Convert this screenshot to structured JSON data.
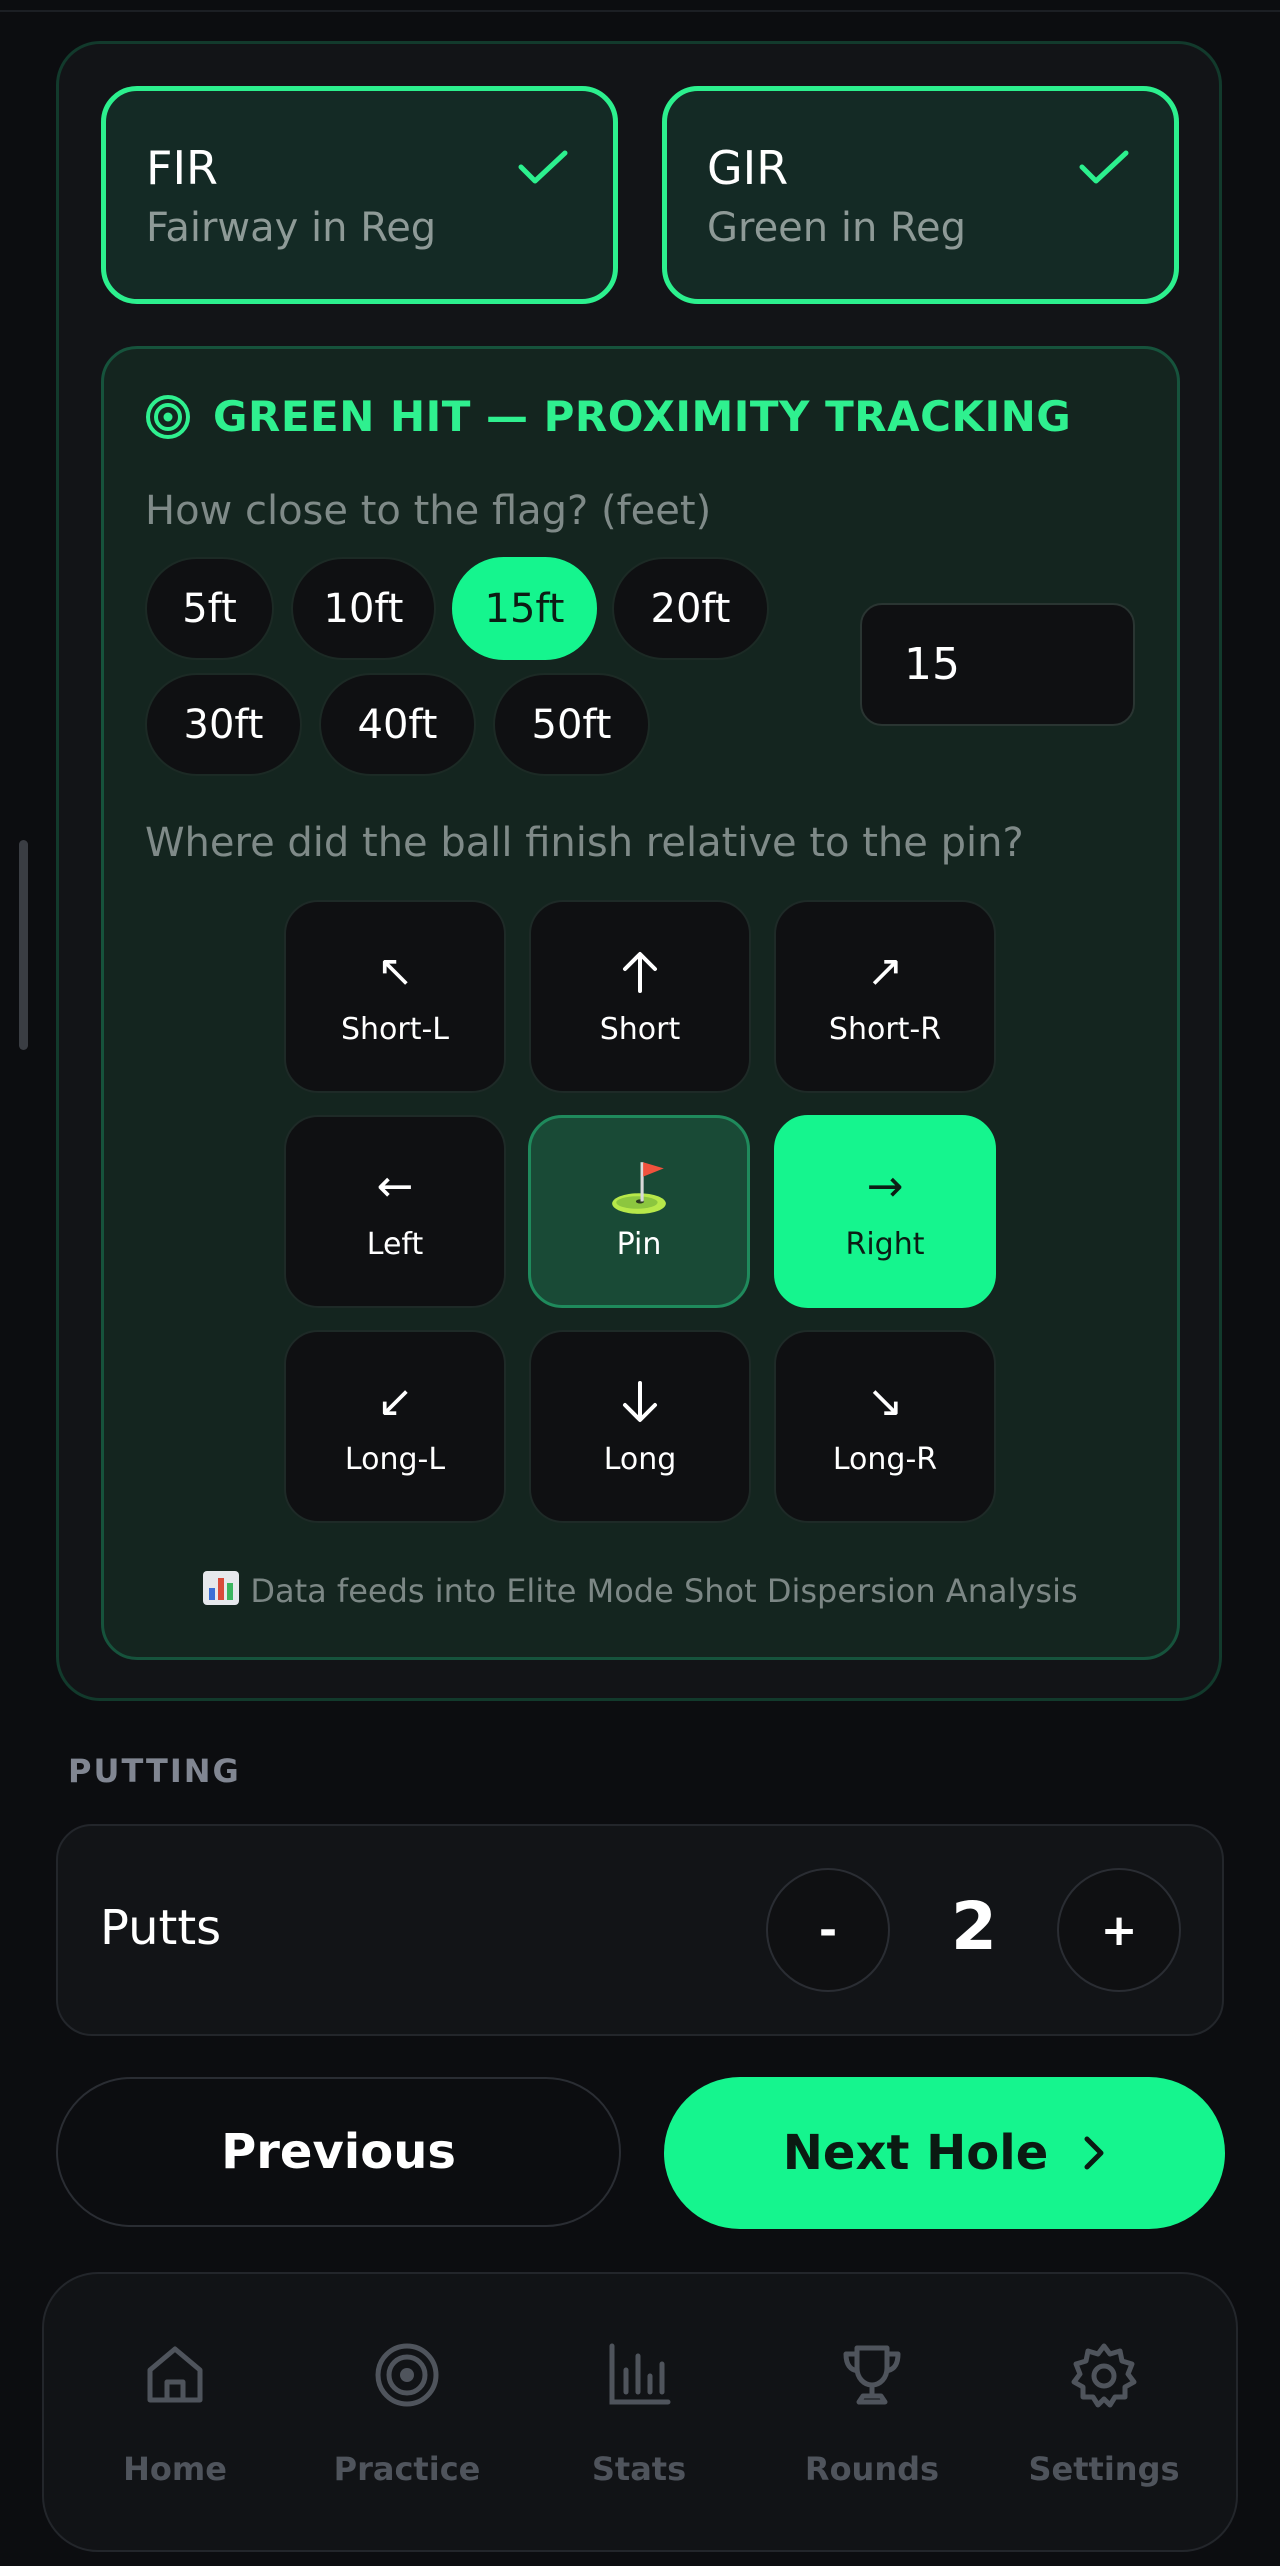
{
  "fir": {
    "title": "FIR",
    "subtitle": "Fairway in Reg",
    "checked": true
  },
  "gir": {
    "title": "GIR",
    "subtitle": "Green in Reg",
    "checked": true
  },
  "proximity": {
    "title": "GREEN HIT — PROXIMITY TRACKING",
    "distance_question": "How close to the flag? (feet)",
    "distance_chips": [
      "5ft",
      "10ft",
      "15ft",
      "20ft",
      "30ft",
      "40ft",
      "50ft"
    ],
    "selected_chip": "15ft",
    "distance_value": "15",
    "position_question": "Where did the ball finish relative to the pin?",
    "positions": [
      {
        "label": "Short-L",
        "icon": "arrow-up-left-icon",
        "glyph": "↖"
      },
      {
        "label": "Short",
        "icon": "arrow-up-icon",
        "glyph": "↑"
      },
      {
        "label": "Short-R",
        "icon": "arrow-up-right-icon",
        "glyph": "↗"
      },
      {
        "label": "Left",
        "icon": "arrow-left-icon",
        "glyph": "←"
      },
      {
        "label": "Pin",
        "icon": "golf-flag-icon",
        "glyph": "⛳"
      },
      {
        "label": "Right",
        "icon": "arrow-right-icon",
        "glyph": "→"
      },
      {
        "label": "Long-L",
        "icon": "arrow-down-left-icon",
        "glyph": "↙"
      },
      {
        "label": "Long",
        "icon": "arrow-down-icon",
        "glyph": "↓"
      },
      {
        "label": "Long-R",
        "icon": "arrow-down-right-icon",
        "glyph": "↘"
      }
    ],
    "selected_position": "Right",
    "footnote": "Data feeds into Elite Mode Shot Dispersion Analysis"
  },
  "putting": {
    "section_label": "PUTTING",
    "label": "Putts",
    "value": "2",
    "decrement": "-",
    "increment": "+"
  },
  "actions": {
    "previous": "Previous",
    "next": "Next Hole"
  },
  "nav": [
    {
      "label": "Home",
      "icon": "home-icon"
    },
    {
      "label": "Practice",
      "icon": "target-icon"
    },
    {
      "label": "Stats",
      "icon": "bar-chart-icon"
    },
    {
      "label": "Rounds",
      "icon": "trophy-icon"
    },
    {
      "label": "Settings",
      "icon": "gear-icon"
    }
  ],
  "colors": {
    "accent": "#15f58e",
    "background": "#0c0d10",
    "card": "#14251f",
    "muted": "#7f8a88"
  }
}
